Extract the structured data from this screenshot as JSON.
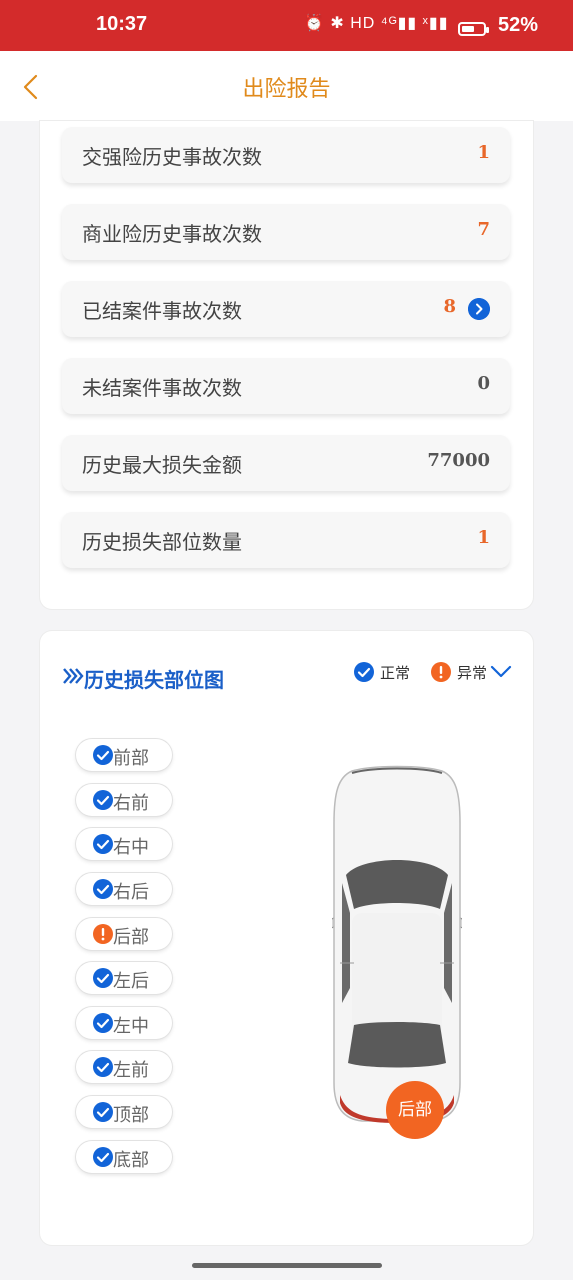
{
  "status_bar": {
    "time": "10:37",
    "icons": "⏰ ✱ HD ⁴ᴳ▮▮ ˣ▮▮",
    "battery": "52%"
  },
  "nav": {
    "title": "出险报告"
  },
  "stats": [
    {
      "label": "交强险历史事故次数",
      "value": "1"
    },
    {
      "label": "商业险历史事故次数",
      "value": "7"
    },
    {
      "label": "已结案件事故次数",
      "value": "8"
    },
    {
      "label": "未结案件事故次数",
      "value": "0"
    },
    {
      "label": "历史最大损失金额",
      "value": "77000"
    },
    {
      "label": "历史损失部位数量",
      "value": "1"
    }
  ],
  "damage_section": {
    "title": "历史损失部位图",
    "legend_normal": "正常",
    "legend_abnormal": "异常",
    "parts": [
      {
        "name": "前部",
        "status": "normal"
      },
      {
        "name": "右前",
        "status": "normal"
      },
      {
        "name": "右中",
        "status": "normal"
      },
      {
        "name": "右后",
        "status": "normal"
      },
      {
        "name": "后部",
        "status": "abnormal"
      },
      {
        "name": "左后",
        "status": "normal"
      },
      {
        "name": "左中",
        "status": "normal"
      },
      {
        "name": "左前",
        "status": "normal"
      },
      {
        "name": "顶部",
        "status": "normal"
      },
      {
        "name": "底部",
        "status": "normal"
      }
    ],
    "highlight_label": "后部"
  },
  "colors": {
    "status_bar": "#d32b2b",
    "accent_orange": "#e8672a",
    "title_orange": "#e08a1b",
    "blue": "#1264d8"
  }
}
